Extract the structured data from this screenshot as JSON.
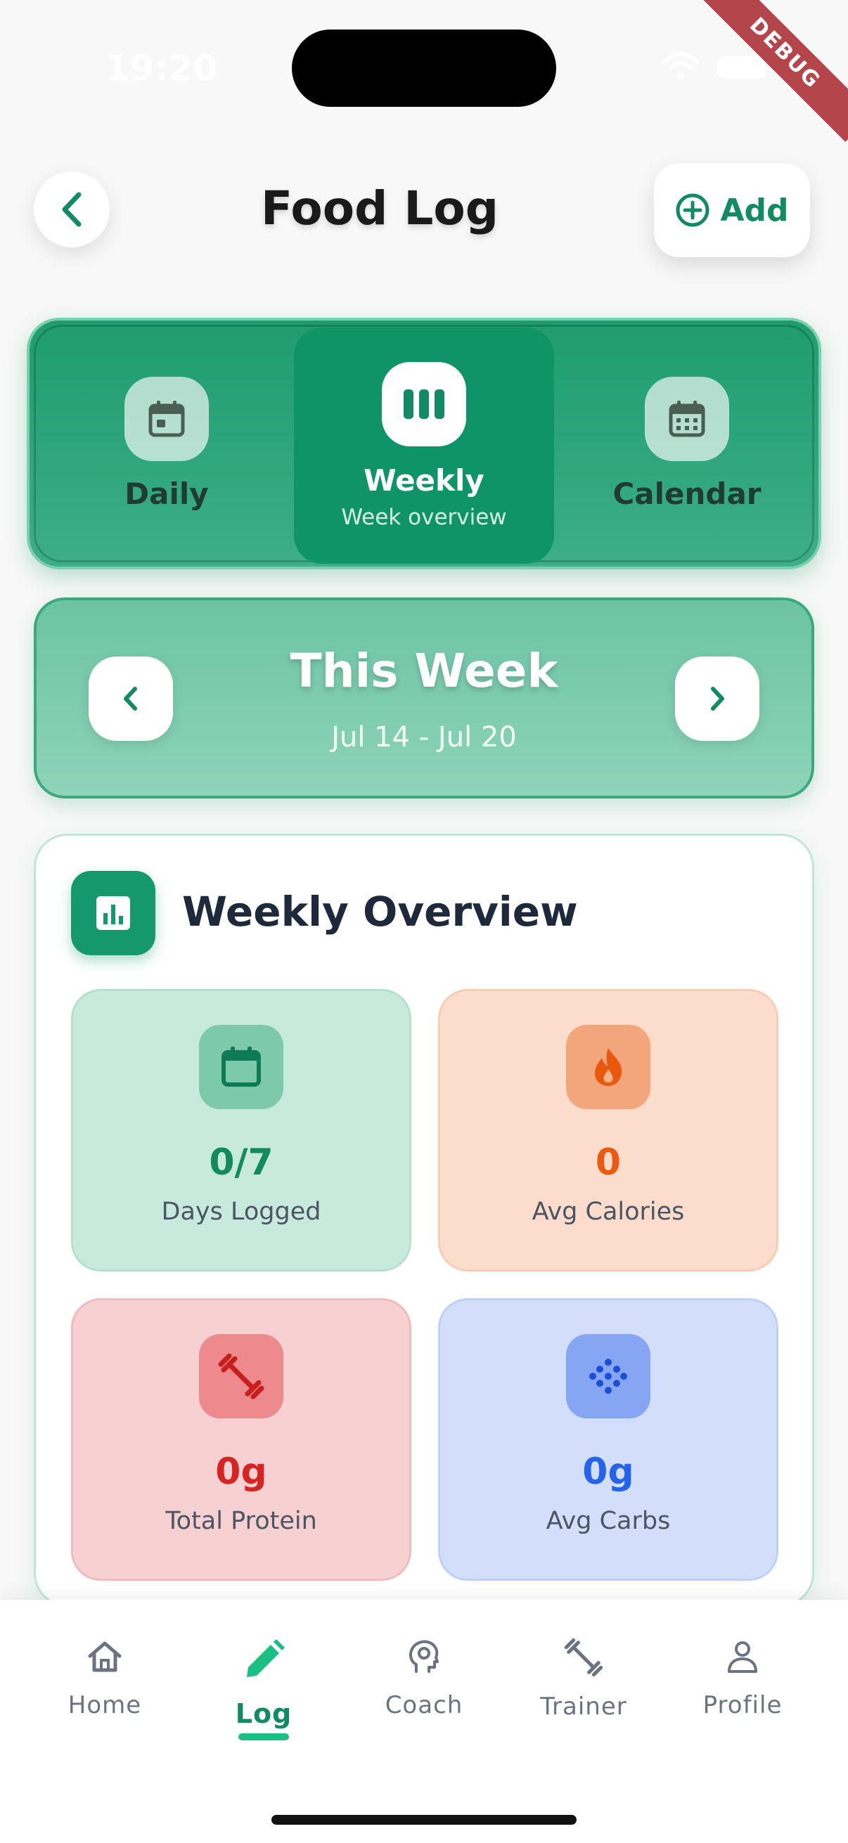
{
  "status_bar": {
    "time": "19:20",
    "debug": "DEBUG"
  },
  "header": {
    "title": "Food Log",
    "add_label": "Add"
  },
  "view_tabs": [
    {
      "label": "Daily",
      "icon": "calendar-day-icon"
    },
    {
      "label": "Weekly",
      "subtitle": "Week overview",
      "icon": "week-bars-icon",
      "active": true
    },
    {
      "label": "Calendar",
      "icon": "calendar-month-icon"
    }
  ],
  "week_nav": {
    "title": "This Week",
    "range": "Jul 14 - Jul 20"
  },
  "overview": {
    "title": "Weekly Overview",
    "stats": [
      {
        "value": "0/7",
        "label": "Days Logged",
        "icon": "calendar-icon",
        "color": "#128a62"
      },
      {
        "value": "0",
        "label": "Avg Calories",
        "icon": "flame-icon",
        "color": "#ea5a12"
      },
      {
        "value": "0g",
        "label": "Total Protein",
        "icon": "dumbbell-icon",
        "color": "#d62424"
      },
      {
        "value": "0g",
        "label": "Avg Carbs",
        "icon": "grain-icon",
        "color": "#2563eb"
      }
    ]
  },
  "bottom_nav": [
    {
      "label": "Home",
      "icon": "home-icon"
    },
    {
      "label": "Log",
      "icon": "pencil-icon",
      "active": true
    },
    {
      "label": "Coach",
      "icon": "brain-icon"
    },
    {
      "label": "Trainer",
      "icon": "dumbbell-icon"
    },
    {
      "label": "Profile",
      "icon": "person-icon"
    }
  ],
  "colors": {
    "brand": "#128a62",
    "accent": "#1bbf83"
  }
}
